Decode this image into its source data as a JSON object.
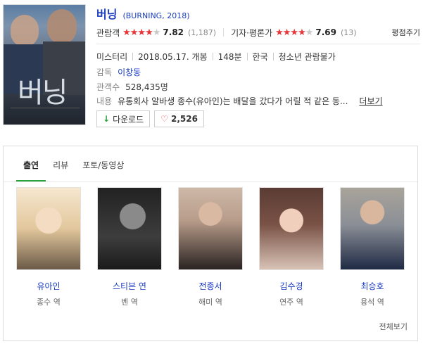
{
  "movie": {
    "title": "버닝",
    "subtitle": "(BURNING, 2018)"
  },
  "ratings": {
    "audience": {
      "label": "관람객",
      "stars_filled": 4,
      "stars_total": 5,
      "score": "7.82",
      "count": "(1,187)"
    },
    "critics": {
      "label": "기자·평론가",
      "stars_filled": 4,
      "stars_total": 5,
      "score": "7.69",
      "count": "(13)"
    },
    "link": "평점주기"
  },
  "info": {
    "genre": "미스터리",
    "release": "2018.05.17. 개봉",
    "runtime": "148분",
    "country": "한국",
    "rating": "청소년 관람불가",
    "director_label": "감독",
    "director": "이창동",
    "audience_label": "관객수",
    "audience_value": "528,435명",
    "plot_label": "내용",
    "plot": "유통회사 알바생 종수(유아인)는 배달을 갔다가 어릴 적 같은 동...",
    "more": "더보기"
  },
  "buttons": {
    "download": "다운로드",
    "likes": "2,526"
  },
  "tabs": [
    {
      "label": "출연"
    },
    {
      "label": "리뷰"
    },
    {
      "label": "포토/동영상"
    }
  ],
  "cast": [
    {
      "name": "유아인",
      "role": "종수 역"
    },
    {
      "name": "스티븐 연",
      "role": "벤 역"
    },
    {
      "name": "전종서",
      "role": "해미 역"
    },
    {
      "name": "김수경",
      "role": "연주 역"
    },
    {
      "name": "최승호",
      "role": "용석 역"
    }
  ],
  "see_all": "전체보기",
  "colors": {
    "link": "#1a3dc1",
    "star": "#e8353a",
    "accent": "#27a33b"
  }
}
